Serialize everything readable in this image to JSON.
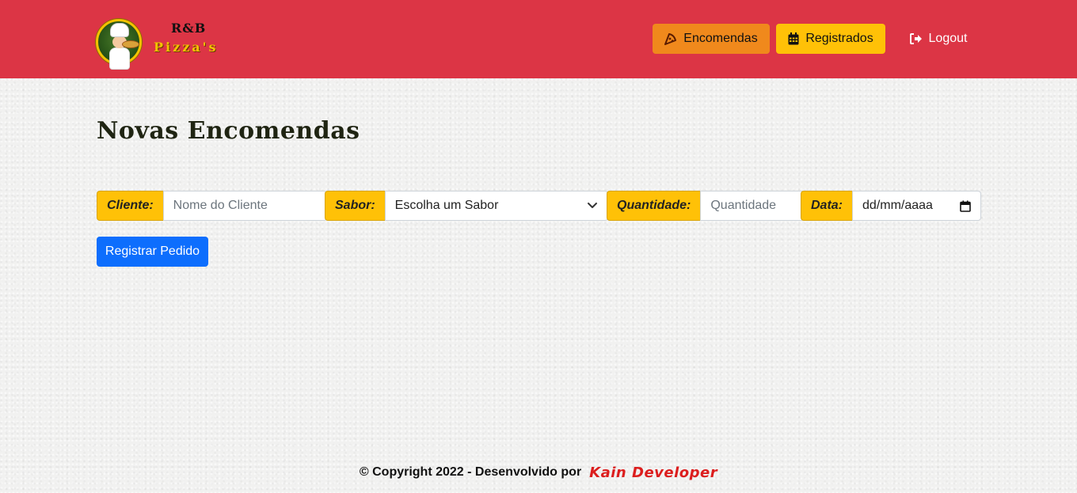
{
  "brand": {
    "top_text": "R&B",
    "bottom_text": "Pizza's"
  },
  "nav": {
    "encomendas": "Encomendas",
    "registrados": "Registrados",
    "logout": "Logout"
  },
  "main": {
    "title": "Novas Encomendas",
    "form": {
      "cliente_label": "Cliente:",
      "cliente_placeholder": "Nome do Cliente",
      "sabor_label": "Sabor:",
      "sabor_selected": "Escolha um Sabor",
      "quantidade_label": "Quantidade:",
      "quantidade_placeholder": "Quantidade",
      "data_label": "Data:",
      "data_placeholder": "dd/mm/aaaa",
      "submit_label": "Registrar Pedido"
    }
  },
  "footer": {
    "copyright": "© Copyright 2022 - Desenvolvido por",
    "developer": "Kain Developer"
  },
  "colors": {
    "navbar": "#dc3545",
    "encomendas_btn": "#f0891c",
    "registrados_btn": "#ffc107",
    "submit_btn": "#0d6efd",
    "developer_text": "#dc1e1e"
  },
  "icons": {
    "encomendas": "pizza-slice-icon",
    "registrados": "calendar-icon",
    "logout": "sign-out-icon",
    "sabor_dropdown": "chevron-down-icon",
    "data_picker": "calendar-icon"
  }
}
